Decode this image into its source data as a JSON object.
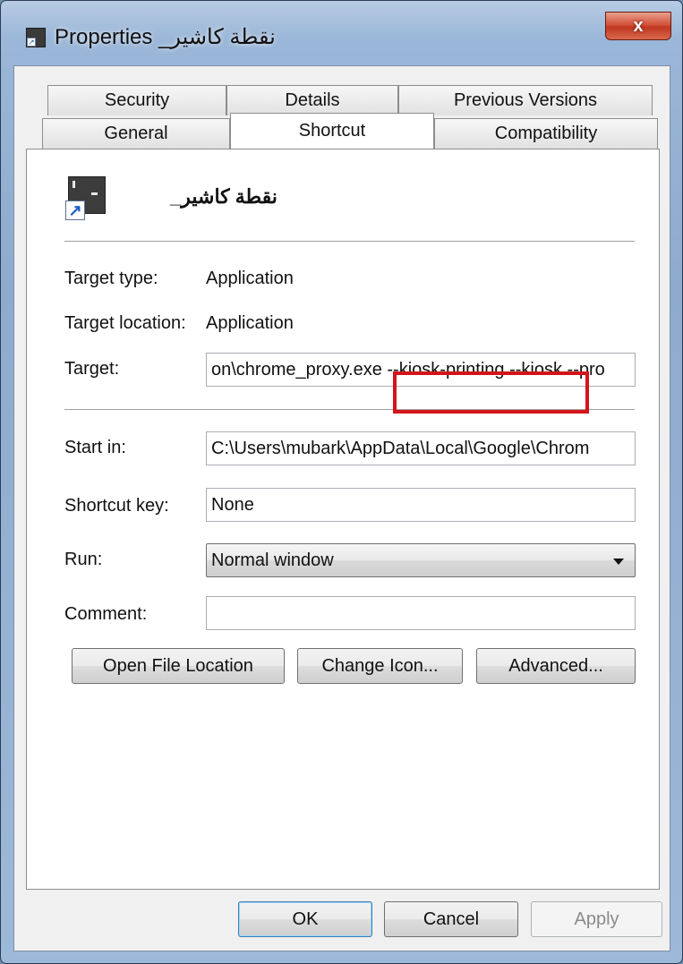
{
  "window": {
    "title": "نقطة كاشير_ Properties",
    "close_label": "x"
  },
  "tabs": {
    "row1": [
      "Security",
      "Details",
      "Previous Versions"
    ],
    "row2": [
      "General",
      "Shortcut",
      "Compatibility"
    ],
    "selected": "Shortcut"
  },
  "shortcut": {
    "name": "نقطة كاشير_",
    "icon": "shortcut-arrow-icon"
  },
  "fields": {
    "target_type_label": "Target type:",
    "target_type_value": "Application",
    "target_location_label": "Target location:",
    "target_location_value": "Application",
    "target_label": "Target:",
    "target_value": "on\\chrome_proxy.exe --kiosk-printing --kiosk --pro",
    "start_in_label": "Start in:",
    "start_in_value": "C:\\Users\\mubark\\AppData\\Local\\Google\\Chrom",
    "shortcut_key_label": "Shortcut key:",
    "shortcut_key_value": "None",
    "run_label": "Run:",
    "run_value": "Normal window",
    "comment_label": "Comment:",
    "comment_value": ""
  },
  "buttons": {
    "open_file_location": "Open File Location",
    "change_icon": "Change Icon...",
    "advanced": "Advanced...",
    "ok": "OK",
    "cancel": "Cancel",
    "apply": "Apply"
  },
  "colors": {
    "highlight": "#d4141b",
    "titlebar": "#9ab6d8"
  }
}
